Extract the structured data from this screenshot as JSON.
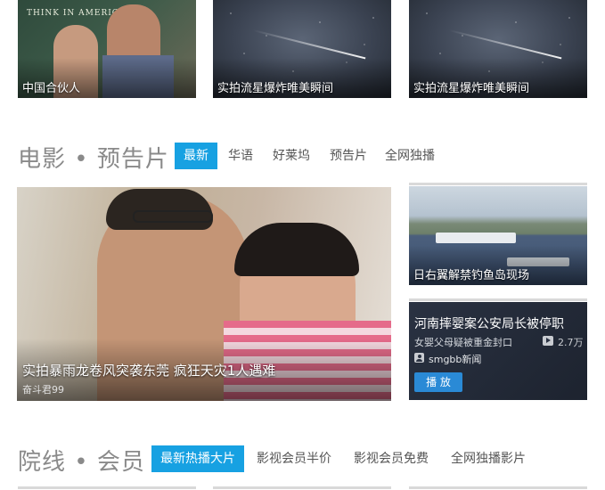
{
  "top_row": [
    {
      "caption": "中国合伙人",
      "board_text": "THINK IN AMERICAN"
    },
    {
      "caption": "实拍流星爆炸唯美瞬间"
    },
    {
      "caption": "实拍流星爆炸唯美瞬间"
    }
  ],
  "movie_section": {
    "title": "电影 • 预告片",
    "tabs": [
      "最新",
      "华语",
      "好莱坞",
      "预告片",
      "全网独播"
    ],
    "active_tab": "最新",
    "feature": {
      "title": "实拍暴雨龙卷风突袭东莞 疯狂天灾1人遇难",
      "author": "奋斗君99"
    },
    "side_top": {
      "caption": "日右翼解禁钓鱼岛现场"
    },
    "side_bottom": {
      "title": "河南摔婴案公安局长被停职",
      "subtitle": "女婴父母疑被重金封口",
      "views": "2.7万",
      "source": "smgbb新闻",
      "play_label": "播 放"
    }
  },
  "member_section": {
    "title": "院线 • 会员",
    "tabs": [
      "最新热播大片",
      "影视会员半价",
      "影视会员免费",
      "全网独播影片"
    ],
    "active_tab": "最新热播大片"
  },
  "colors": {
    "accent": "#17a1e2",
    "title_gray": "#8a8a8a"
  }
}
